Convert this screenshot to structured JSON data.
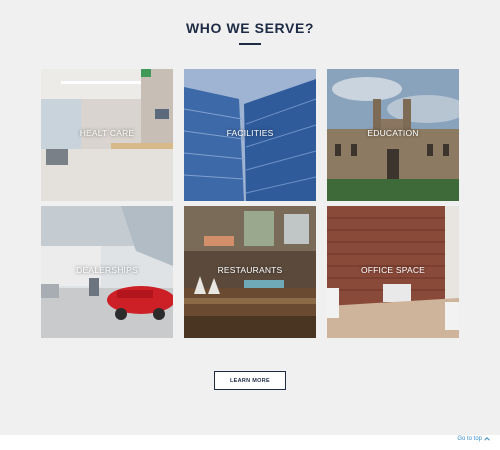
{
  "section": {
    "title": "WHO WE SERVE?"
  },
  "tiles": [
    {
      "label": "HEALT CARE"
    },
    {
      "label": "FACILITIES"
    },
    {
      "label": "EDUCATION"
    },
    {
      "label": "DEALERSHIPS"
    },
    {
      "label": "RESTAURANTS"
    },
    {
      "label": "OFFICE SPACE"
    }
  ],
  "cta": {
    "label": "LEARN MORE"
  },
  "footer": {
    "goto_top": "Go to top"
  },
  "colors": {
    "heading": "#1d2b45",
    "link": "#3a8fd0",
    "background": "#f0f0f0"
  },
  "icons": {
    "goto_top": "chevron-up-icon"
  }
}
